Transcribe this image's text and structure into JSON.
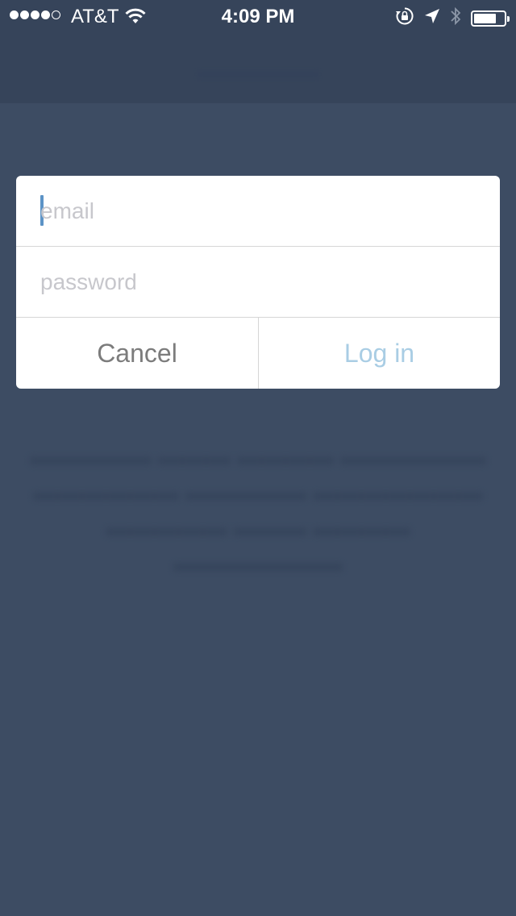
{
  "status_bar": {
    "carrier": "AT&T",
    "time": "4:09 PM",
    "signal_bars_filled": 4,
    "signal_bars_total": 5,
    "battery_level": 0.75,
    "icons": [
      "wifi-icon",
      "rotation-lock-icon",
      "location-arrow-icon",
      "bluetooth-icon",
      "battery-icon"
    ]
  },
  "login_dialog": {
    "email_placeholder": "email",
    "email_value": "",
    "password_placeholder": "password",
    "password_value": "",
    "cancel_label": "Cancel",
    "login_label": "Log in"
  },
  "colors": {
    "background": "#3d4c63",
    "caret": "#5c93c6",
    "login_text": "#a9cde4",
    "cancel_text": "#7c7c7c",
    "placeholder": "#c7c7cc"
  }
}
